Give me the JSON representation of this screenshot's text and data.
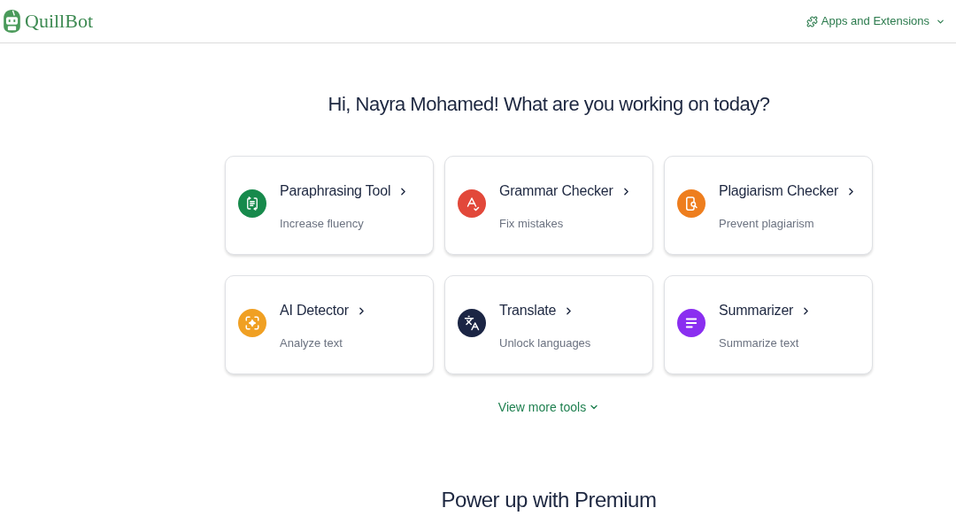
{
  "header": {
    "logo_text": "QuillBot",
    "apps_menu": {
      "label": "Apps and Extensions"
    }
  },
  "greeting": "Hi, Nayra Mohamed! What are you working on today?",
  "tools": [
    {
      "kind": "paraphraser",
      "name": "Paraphrasing Tool",
      "description": "Increase fluency",
      "color": "#178a4c"
    },
    {
      "kind": "grammar",
      "name": "Grammar Checker",
      "description": "Fix mistakes",
      "color": "#e2483a"
    },
    {
      "kind": "plagiarism",
      "name": "Plagiarism Checker",
      "description": "Prevent plagiarism",
      "color": "#ee7e1e"
    },
    {
      "kind": "ai_detector",
      "name": "AI Detector",
      "description": "Analyze text",
      "color": "#f0a023"
    },
    {
      "kind": "translate",
      "name": "Translate",
      "description": "Unlock languages",
      "color": "#1b2544"
    },
    {
      "kind": "summarizer",
      "name": "Summarizer",
      "description": "Summarize text",
      "color": "#8a2ef0"
    }
  ],
  "view_more": {
    "label": "View more tools"
  },
  "premium_heading": "Power up with Premium"
}
